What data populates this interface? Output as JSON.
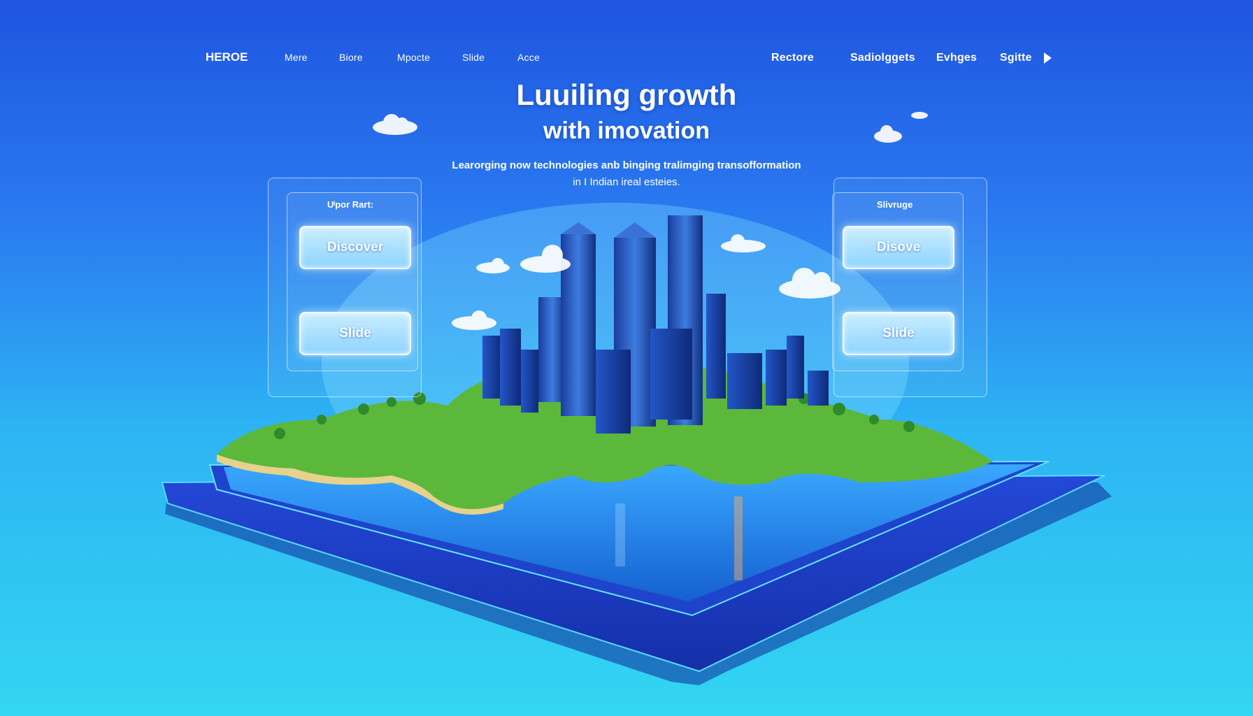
{
  "nav": {
    "brand": "HEROE",
    "left_links": [
      "Mere",
      "Biore",
      "Mpocte",
      "Slide",
      "Acce"
    ],
    "right_links": [
      "Rectore",
      "Sadiolggets",
      "Evhges",
      "Sgitte"
    ]
  },
  "hero": {
    "title_line1": "Luuiling growth",
    "title_line2": "with imovation",
    "subtitle_line1": "Learorging now technologies anb binging tralimging transofformation",
    "subtitle_line2": "in I Indian ireal esteies."
  },
  "left_panel": {
    "label": "Uˡpor Rart:",
    "primary_button": "Discover",
    "secondary_button": "Slide"
  },
  "right_panel": {
    "label": "Slivruge",
    "primary_button": "Disove",
    "secondary_button": "Slide"
  },
  "colors": {
    "background_top": "#1f55e0",
    "background_bottom": "#33d6f2",
    "platform": "#1b3fc4",
    "land": "#5cb83a",
    "water": "#1f8fe0"
  }
}
